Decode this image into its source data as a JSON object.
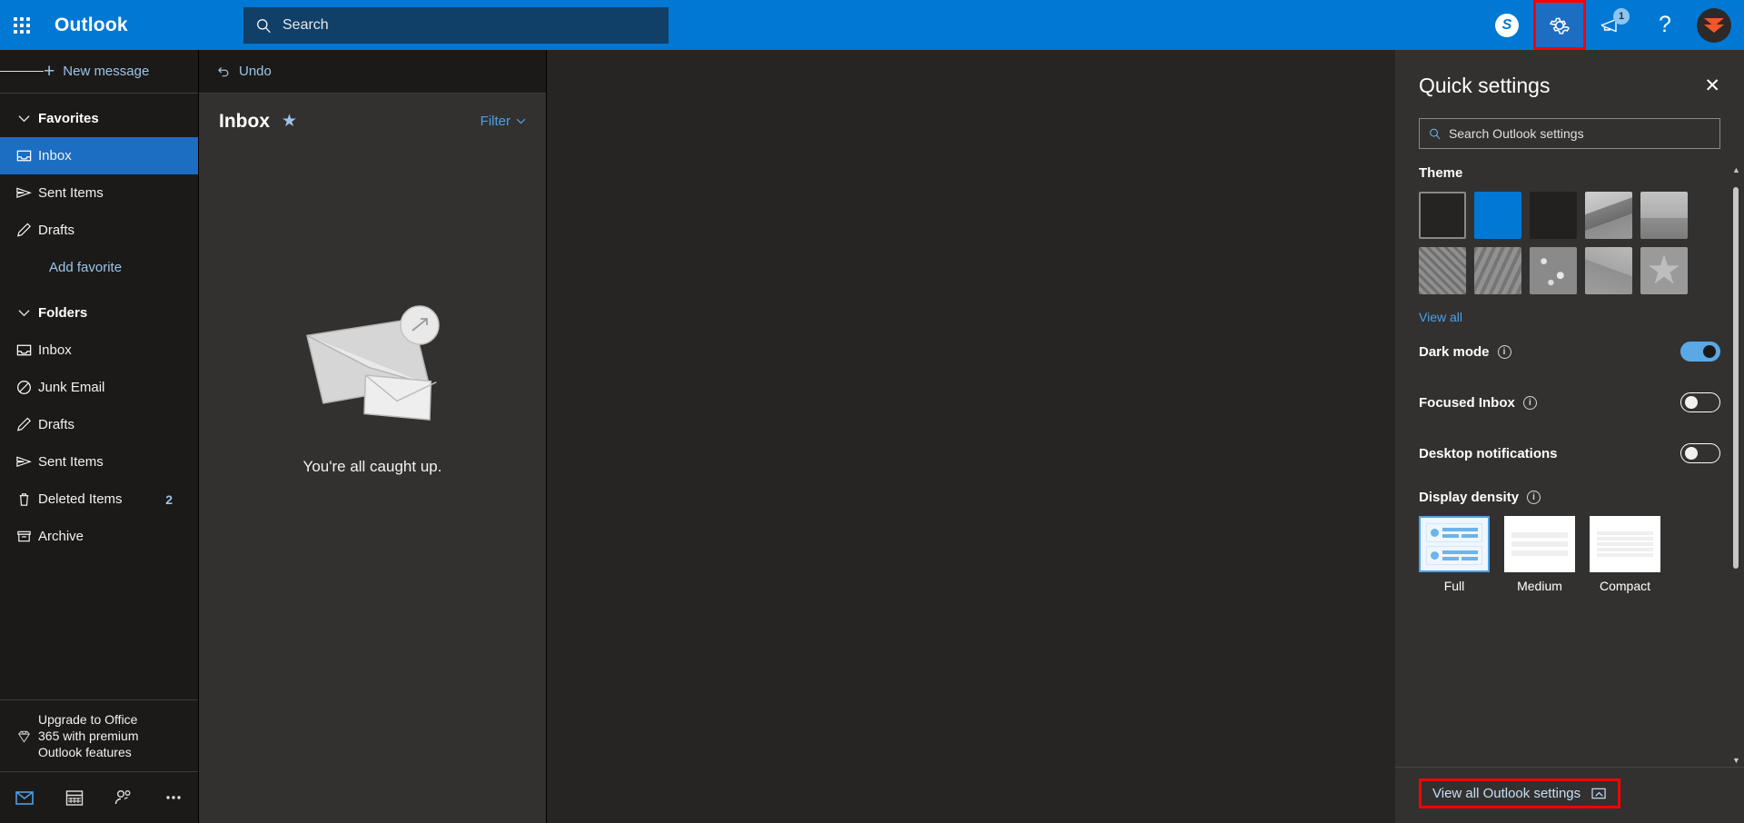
{
  "topbar": {
    "waffle_label": "app-launcher",
    "brand": "Outlook",
    "search": {
      "value": "",
      "placeholder": "Search"
    },
    "skype_label": "S",
    "notification_badge": "1",
    "help_label": "?"
  },
  "toolbar": {
    "new_message": "New message",
    "plus": "+",
    "undo": "Undo"
  },
  "sidebar": {
    "favorites": {
      "title": "Favorites",
      "items": [
        {
          "label": "Inbox",
          "icon": "inbox-icon",
          "selected": true
        },
        {
          "label": "Sent Items",
          "icon": "send-icon",
          "selected": false
        },
        {
          "label": "Drafts",
          "icon": "pencil-icon",
          "selected": false
        }
      ],
      "add_favorite": "Add favorite"
    },
    "folders": {
      "title": "Folders",
      "items": [
        {
          "label": "Inbox",
          "icon": "inbox-icon",
          "count": ""
        },
        {
          "label": "Junk Email",
          "icon": "block-icon",
          "count": ""
        },
        {
          "label": "Drafts",
          "icon": "pencil-icon",
          "count": ""
        },
        {
          "label": "Sent Items",
          "icon": "send-icon",
          "count": ""
        },
        {
          "label": "Deleted Items",
          "icon": "trash-icon",
          "count": "2"
        },
        {
          "label": "Archive",
          "icon": "archive-icon",
          "count": ""
        }
      ]
    },
    "promo": "Upgrade to Office 365 with premium Outlook features",
    "bottom_nav": [
      {
        "name": "mail",
        "icon": "mail-icon",
        "active": true
      },
      {
        "name": "calendar",
        "icon": "calendar-icon",
        "active": false
      },
      {
        "name": "people",
        "icon": "people-icon",
        "active": false
      },
      {
        "name": "more",
        "icon": "ellipsis-icon",
        "active": false
      }
    ]
  },
  "message_list": {
    "title": "Inbox",
    "star": "★",
    "filter": "Filter",
    "empty_text": "You're all caught up."
  },
  "settings": {
    "title": "Quick settings",
    "close": "✕",
    "search": {
      "value": "",
      "placeholder": "Search Outlook settings"
    },
    "theme": {
      "title": "Theme",
      "view_all": "View all",
      "selected_index": 0,
      "swatches": [
        {
          "name": "theme-default-dark",
          "kind": "solid",
          "color": "#252423"
        },
        {
          "name": "theme-blue",
          "kind": "solid",
          "color": "#0078d4"
        },
        {
          "name": "theme-black",
          "kind": "solid",
          "color": "#222120"
        },
        {
          "name": "theme-mountain",
          "kind": "image-mountain",
          "color": "#8f8f8f"
        },
        {
          "name": "theme-palm-trees",
          "kind": "image-palms",
          "color": "#909090"
        },
        {
          "name": "theme-circuit",
          "kind": "image-circuit",
          "color": "#8b8b8b"
        },
        {
          "name": "theme-elevation",
          "kind": "image-elevation",
          "color": "#8b8b8b"
        },
        {
          "name": "theme-bokeh",
          "kind": "image-bokeh",
          "color": "#8a8a8a"
        },
        {
          "name": "theme-curves",
          "kind": "image-curves",
          "color": "#a2a2a2"
        },
        {
          "name": "theme-star",
          "kind": "image-star",
          "color": "#a0a0a0"
        }
      ]
    },
    "toggles": [
      {
        "label": "Dark mode",
        "on": true,
        "info": "i"
      },
      {
        "label": "Focused Inbox",
        "on": false,
        "info": "i"
      },
      {
        "label": "Desktop notifications",
        "on": false,
        "info": "i"
      }
    ],
    "density": {
      "title": "Display density",
      "info": "i",
      "selected": "Full",
      "options": [
        {
          "label": "Full"
        },
        {
          "label": "Medium"
        },
        {
          "label": "Compact"
        }
      ]
    },
    "footer_link": "View all Outlook settings"
  },
  "colors": {
    "brand_blue": "#0078d4",
    "accent_link": "#4ca0e8",
    "highlight_red": "#ff0000",
    "selected_nav": "#1b6ec2",
    "panel_bg": "#323130",
    "nav_bg": "#1b1a19"
  }
}
